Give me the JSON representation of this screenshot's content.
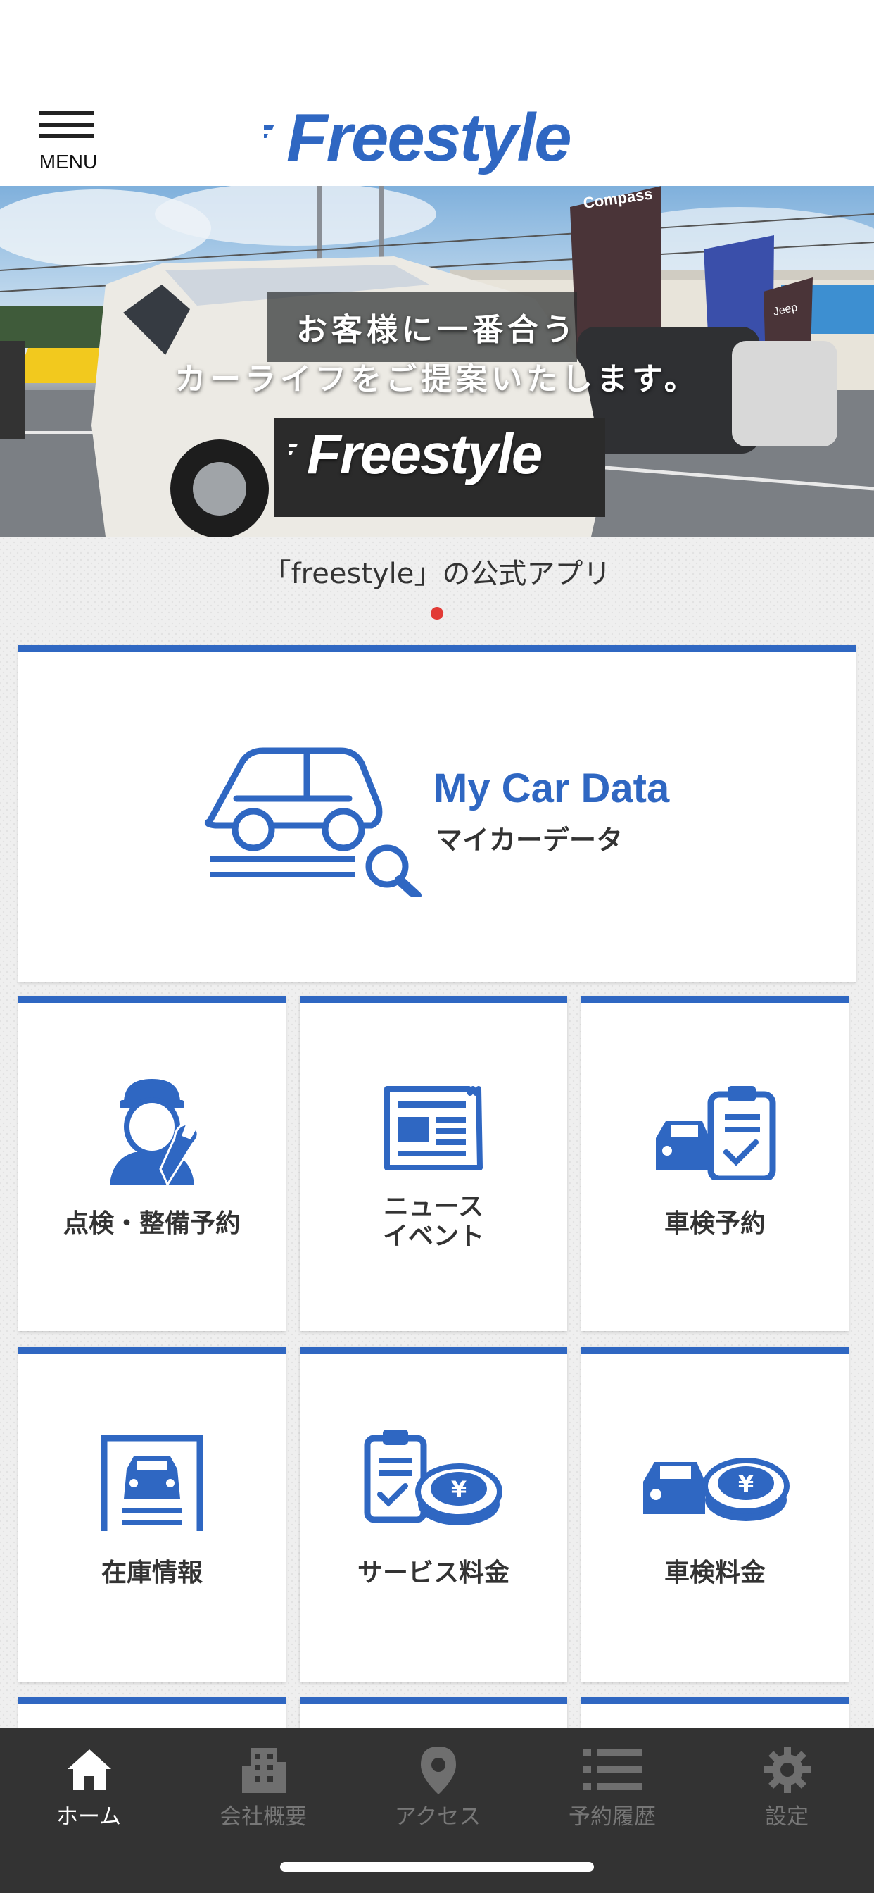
{
  "header": {
    "menu_label": "MENU",
    "logo_text": "Freestyle"
  },
  "hero": {
    "line1": "お客様に一番合う",
    "line2": "カーライフをご提案いたします。",
    "logo_text": "Freestyle",
    "flag1_text": "Compass",
    "flag3_text": "Jeep"
  },
  "caption": "「freestyle」の公式アプリ",
  "mycar": {
    "title": "My Car Data",
    "subtitle": "マイカーデータ"
  },
  "tiles": [
    {
      "label": "点検・整備予約"
    },
    {
      "label_line1": "ニュース",
      "label_line2": "イベント"
    },
    {
      "label": "車検予約"
    },
    {
      "label": "在庫情報"
    },
    {
      "label": "サービス料金"
    },
    {
      "label": "車検料金"
    }
  ],
  "tabbar": [
    {
      "label": "ホーム",
      "icon": "home-icon",
      "active": true
    },
    {
      "label": "会社概要",
      "icon": "building-icon"
    },
    {
      "label": "アクセス",
      "icon": "map-pin-icon"
    },
    {
      "label": "予約履歴",
      "icon": "list-icon"
    },
    {
      "label": "設定",
      "icon": "gear-icon"
    }
  ],
  "colors": {
    "accent": "#2f67c2",
    "tabbar": "#333333",
    "indicator": "#e23b36"
  }
}
